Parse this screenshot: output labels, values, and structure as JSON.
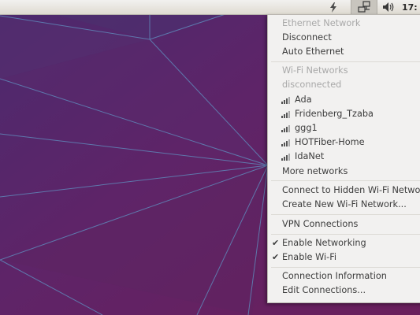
{
  "topbar": {
    "power_icon": "lightning-icon",
    "network_icon": "network-wired-icon",
    "sound_icon": "speaker-icon",
    "clock": "17:"
  },
  "menu": {
    "ethernet_header": "Ethernet Network",
    "disconnect": "Disconnect",
    "auto_ethernet": "Auto Ethernet",
    "wifi_header": "Wi-Fi Networks",
    "wifi_status": "disconnected",
    "networks": [
      "Ada",
      "Fridenberg_Tzaba",
      "ggg1",
      "HOTFiber-Home",
      "IdaNet"
    ],
    "more_networks": "More networks",
    "connect_hidden": "Connect to Hidden Wi-Fi Network...",
    "create_new": "Create New Wi-Fi Network...",
    "vpn": "VPN Connections",
    "enable_networking": "Enable Networking",
    "enable_wifi": "Enable Wi-Fi",
    "check_mark": "✔",
    "connection_info": "Connection Information",
    "edit_connections": "Edit Connections..."
  }
}
